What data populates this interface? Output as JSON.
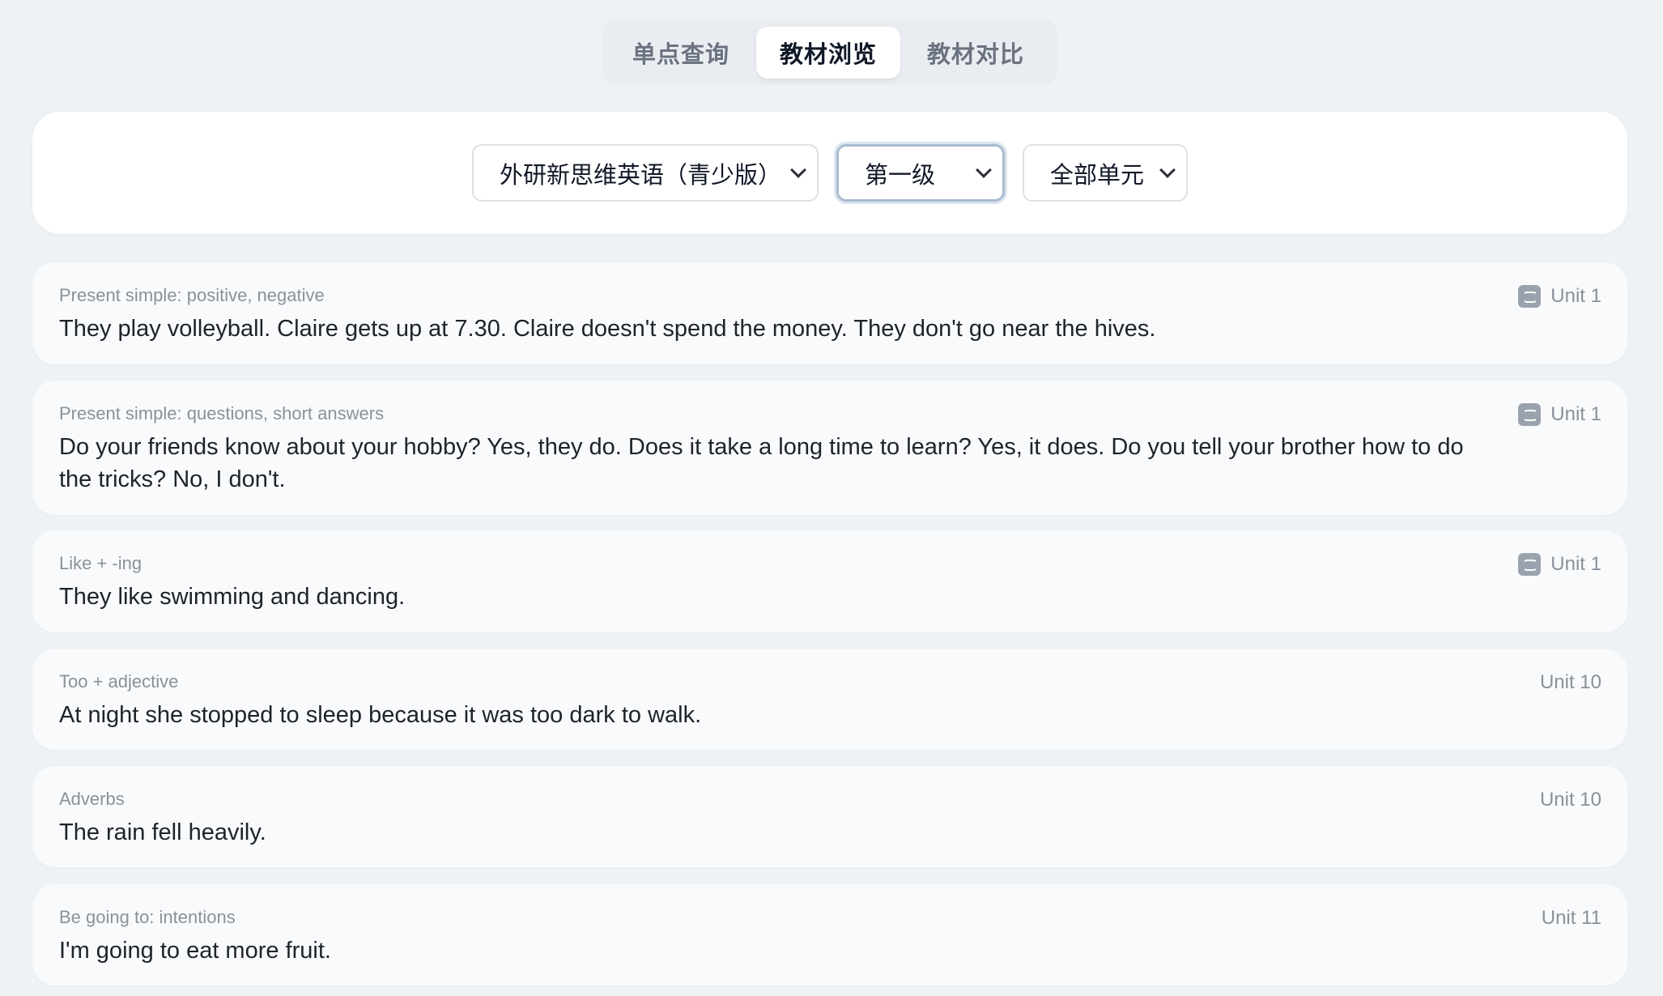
{
  "tabs": [
    {
      "label": "单点查询",
      "active": false
    },
    {
      "label": "教材浏览",
      "active": true
    },
    {
      "label": "教材对比",
      "active": false
    }
  ],
  "filters": {
    "textbook": "外研新思维英语（青少版）",
    "level": "第一级",
    "unit": "全部单元"
  },
  "items": [
    {
      "category": "Present simple: positive, negative",
      "sentence": "They play volleyball. Claire gets up at 7.30. Claire doesn't spend the money. They don't go near the hives.",
      "unit": "Unit 1",
      "icon": "sync-icon"
    },
    {
      "category": "Present simple: questions, short answers",
      "sentence": "Do your friends know about your hobby? Yes, they do. Does it take a long time to learn? Yes, it does. Do you tell your brother how to do the tricks? No, I don't.",
      "unit": "Unit 1",
      "icon": "sync-icon"
    },
    {
      "category": "Like + -ing",
      "sentence": "They like swimming and dancing.",
      "unit": "Unit 1",
      "icon": "sync-icon"
    },
    {
      "category": "Too + adjective",
      "sentence": "At night she stopped to sleep because it was too dark to walk.",
      "unit": "Unit 10",
      "icon": ""
    },
    {
      "category": "Adverbs",
      "sentence": "The rain fell heavily.",
      "unit": "Unit 10",
      "icon": ""
    },
    {
      "category": "Be going to: intentions",
      "sentence": "I'm going to eat more fruit.",
      "unit": "Unit 11",
      "icon": ""
    }
  ]
}
